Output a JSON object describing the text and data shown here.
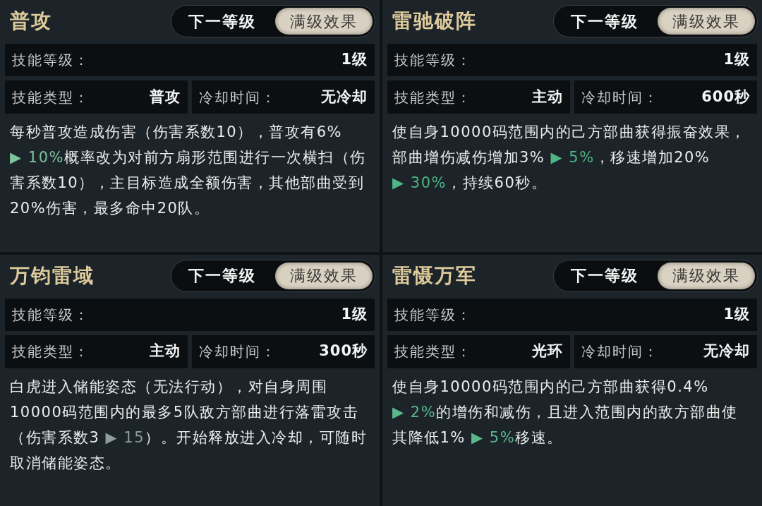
{
  "panels": [
    {
      "title": "普攻",
      "tabs": [
        {
          "label": "下一等级",
          "selected": false
        },
        {
          "label": "满级效果",
          "selected": true
        }
      ],
      "level": {
        "label": "技能等级：",
        "value": "1级"
      },
      "type": {
        "label": "技能类型：",
        "value": "普攻"
      },
      "cooldown": {
        "label": "冷却时间：",
        "value": "无冷却"
      },
      "description": [
        {
          "kind": "plain",
          "text": "每秒普攻造成伤害（伤害系数10），普攻有6% "
        },
        {
          "kind": "change",
          "text": "▶ 10%",
          "color": "#7dc39c"
        },
        {
          "kind": "plain",
          "text": "概率改为对前方扇形范围进行一次横扫（伤害系数10），主目标造成全额伤害，其他部曲受到20%伤害，最多命中20队。"
        }
      ]
    },
    {
      "title": "雷驰破阵",
      "tabs": [
        {
          "label": "下一等级",
          "selected": false
        },
        {
          "label": "满级效果",
          "selected": true
        }
      ],
      "level": {
        "label": "技能等级：",
        "value": "1级"
      },
      "type": {
        "label": "技能类型：",
        "value": "主动"
      },
      "cooldown": {
        "label": "冷却时间：",
        "value": "600秒"
      },
      "description": [
        {
          "kind": "plain",
          "text": "使自身10000码范围内的己方部曲获得振奋效果，部曲增伤减伤增加3% "
        },
        {
          "kind": "change",
          "text": "▶ 5%",
          "color": "#4fb583"
        },
        {
          "kind": "plain",
          "text": "，移速增加20% "
        },
        {
          "kind": "change",
          "text": "▶ 30%",
          "color": "#4fb583"
        },
        {
          "kind": "plain",
          "text": "，持续60秒。"
        }
      ]
    },
    {
      "title": "万钧雷域",
      "tabs": [
        {
          "label": "下一等级",
          "selected": false
        },
        {
          "label": "满级效果",
          "selected": true
        }
      ],
      "level": {
        "label": "技能等级：",
        "value": "1级"
      },
      "type": {
        "label": "技能类型：",
        "value": "主动"
      },
      "cooldown": {
        "label": "冷却时间：",
        "value": "300秒"
      },
      "description": [
        {
          "kind": "plain",
          "text": "白虎进入储能姿态（无法行动），对自身周围10000码范围内的最多5队敌方部曲进行落雷攻击（伤害系数3 "
        },
        {
          "kind": "change",
          "text": "▶ 15",
          "color": "#8e9c9a"
        },
        {
          "kind": "plain",
          "text": "）。开始释放进入冷却，可随时取消储能姿态。"
        }
      ]
    },
    {
      "title": "雷慑万军",
      "tabs": [
        {
          "label": "下一等级",
          "selected": false
        },
        {
          "label": "满级效果",
          "selected": true
        }
      ],
      "level": {
        "label": "技能等级：",
        "value": "1级"
      },
      "type": {
        "label": "技能类型：",
        "value": "光环"
      },
      "cooldown": {
        "label": "冷却时间：",
        "value": "无冷却"
      },
      "description": [
        {
          "kind": "plain",
          "text": "使自身10000码范围内的己方部曲获得0.4% "
        },
        {
          "kind": "change",
          "text": "▶ 2%",
          "color": "#5bb88b"
        },
        {
          "kind": "plain",
          "text": "的增伤和减伤，且进入范围内的敌方部曲使其降低1% "
        },
        {
          "kind": "change",
          "text": "▶ 5%",
          "color": "#5bb88b"
        },
        {
          "kind": "plain",
          "text": "移速。"
        }
      ]
    }
  ]
}
